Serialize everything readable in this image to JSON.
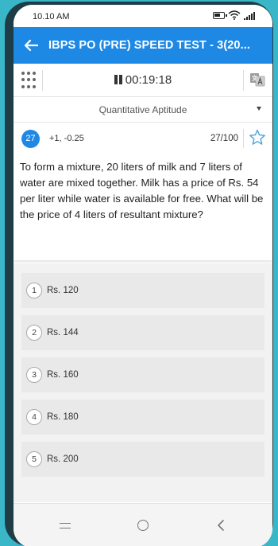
{
  "status_bar": {
    "time": "10.10 AM"
  },
  "app_bar": {
    "title": "IBPS PO (PRE) SPEED TEST - 3(20..."
  },
  "toolbar": {
    "timer": "00:19:18"
  },
  "section": {
    "label": "Quantitative Aptitude"
  },
  "question_header": {
    "number": "27",
    "marks": "+1, -0.25",
    "progress": "27/100"
  },
  "question": {
    "text": "To form a mixture, 20 liters of milk and 7 liters of water are mixed together. Milk has a price of Rs. 54 per liter while water is available for free. What will be the price of 4 liters of resultant mixture?"
  },
  "options": [
    {
      "num": "1",
      "text": "Rs. 120"
    },
    {
      "num": "2",
      "text": "Rs. 144"
    },
    {
      "num": "3",
      "text": "Rs. 160"
    },
    {
      "num": "4",
      "text": "Rs. 180"
    },
    {
      "num": "5",
      "text": "Rs. 200"
    }
  ],
  "colors": {
    "primary": "#1e88e5",
    "background_teal": "#39b7c9",
    "star": "#4aa3df"
  }
}
